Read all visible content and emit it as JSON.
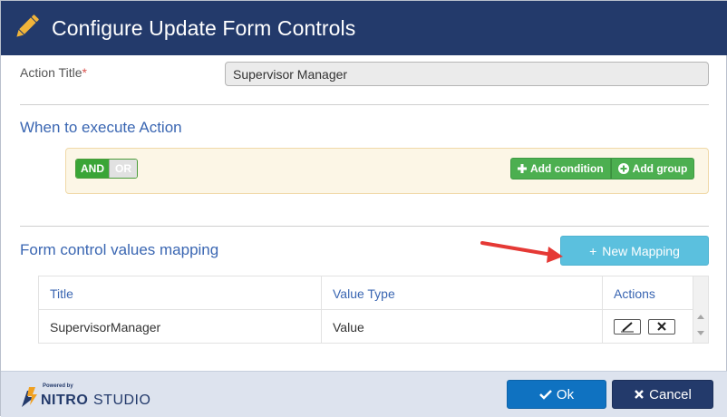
{
  "dialog": {
    "title": "Configure Update Form Controls",
    "icon": "pencil-icon",
    "header_color": "#233a6b"
  },
  "action_title": {
    "label": "Action Title",
    "required_mark": "*",
    "value": "Supervisor Manager"
  },
  "when_section": {
    "heading": "When to execute Action",
    "toggle": {
      "and_label": "AND",
      "or_label": "OR",
      "selected": "AND"
    },
    "add_condition_label": "Add condition",
    "add_group_label": "Add group"
  },
  "mapping_section": {
    "heading": "Form control values mapping",
    "new_mapping_label": "New Mapping",
    "columns": [
      "Title",
      "Value Type",
      "Actions"
    ],
    "rows": [
      {
        "title": "SupervisorManager",
        "value_type": "Value"
      }
    ]
  },
  "footer": {
    "logo_powered": "Powered by",
    "logo_brand": "NITRO",
    "logo_product": "STUDIO",
    "ok_label": "Ok",
    "cancel_label": "Cancel"
  },
  "colors": {
    "accent_blue": "#3a66b2",
    "green": "#4caf50",
    "info": "#5bc0de",
    "ok": "#0f72c1",
    "cancel": "#233a6b",
    "annotation_arrow": "#e53935"
  }
}
